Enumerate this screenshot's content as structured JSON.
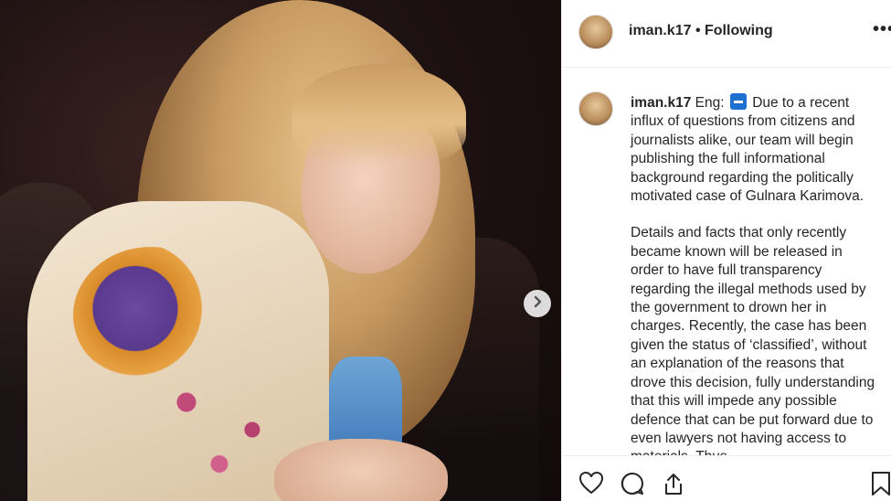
{
  "post": {
    "username": "iman.k17",
    "separator": "•",
    "follow_status": "Following",
    "more_label": "•••"
  },
  "caption": {
    "username": "iman.k17",
    "lang_prefix": "Eng:",
    "flag_icon": "minus-flag-icon",
    "paragraph1": "Due to a recent influx of questions from citizens and journalists alike, our team will begin publishing the full informational background regarding the politically motivated case of Gulnara Karimova.",
    "paragraph2": "Details and facts that only recently became known will be released in order to have full transparency regarding the illegal methods used by the government to drown her in charges. Recently, the case has been given the status of ‘classified’, without an explanation of the reasons that drove this decision, fully understanding that this will impede any possible defence that can be put forward due to even lawyers not having access to materials. Thus"
  },
  "icons": {
    "next": "chevron-right-icon",
    "like": "heart-icon",
    "comment": "comment-icon",
    "share": "share-icon",
    "save": "bookmark-icon"
  },
  "colors": {
    "text": "#262626",
    "border": "#efefef",
    "flag": "#1f6fd0"
  }
}
